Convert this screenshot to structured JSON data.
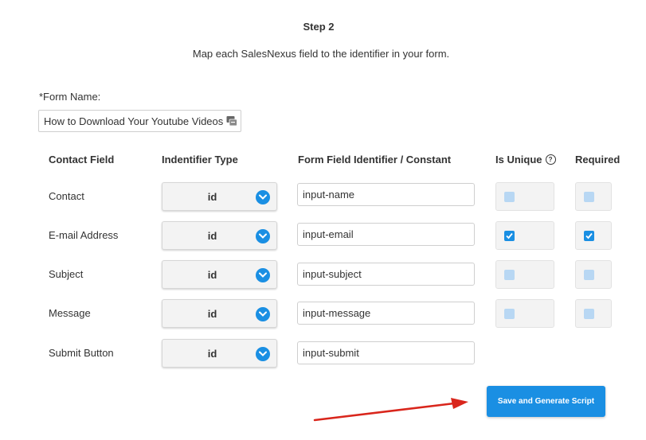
{
  "step": {
    "title": "Step 2",
    "description": "Map each SalesNexus field to the identifier in your form."
  },
  "form_name": {
    "label": "*Form Name:",
    "value": "How to Download Your Youtube Videos"
  },
  "table": {
    "headers": {
      "contact_field": "Contact Field",
      "identifier_type": "Indentifier Type",
      "form_field": "Form Field Identifier / Constant",
      "is_unique": "Is Unique",
      "required": "Required"
    },
    "rows": [
      {
        "contact_field": "Contact",
        "identifier_type": "id",
        "identifier": "input-name",
        "is_unique": false,
        "required": false
      },
      {
        "contact_field": "E-mail Address",
        "identifier_type": "id",
        "identifier": "input-email",
        "is_unique": true,
        "required": true
      },
      {
        "contact_field": "Subject",
        "identifier_type": "id",
        "identifier": "input-subject",
        "is_unique": false,
        "required": false
      },
      {
        "contact_field": "Message",
        "identifier_type": "id",
        "identifier": "input-message",
        "is_unique": false,
        "required": false
      },
      {
        "contact_field": "Submit Button",
        "identifier_type": "id",
        "identifier": "input-submit"
      }
    ]
  },
  "actions": {
    "submit_label": "Save and Generate Script"
  },
  "colors": {
    "accent": "#1a8fe3",
    "annotation_arrow": "#d9261c"
  },
  "icons": {
    "help": "question-circle-icon",
    "dropdown": "chevron-down-icon",
    "checkbox": "checkmark-icon",
    "field_extension": "autofill-icon",
    "annotation": "red-arrow-icon"
  }
}
